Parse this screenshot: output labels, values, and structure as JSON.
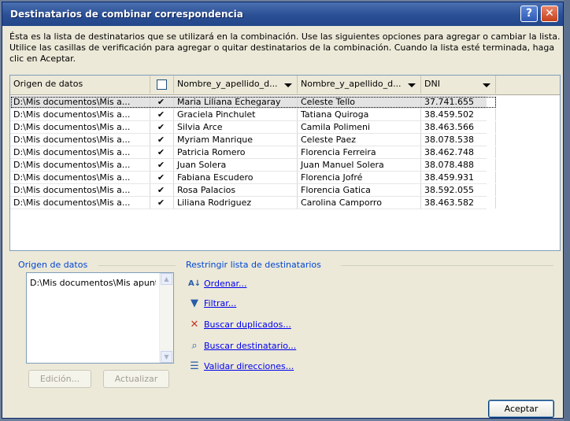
{
  "window": {
    "title": "Destinatarios de combinar correspondencia",
    "help_glyph": "?",
    "close_glyph": "✕"
  },
  "description": "Ésta es la lista de destinatarios que se utilizará en la combinación. Use las siguientes opciones para agregar o cambiar la lista. Utilice las casillas de verificación para agregar o quitar destinatarios de la combinación. Cuando la lista esté terminada, haga clic en Aceptar.",
  "grid": {
    "headers": {
      "origen": "Origen de datos",
      "nombre1": "Nombre_y_apellido_d...",
      "nombre2": "Nombre_y_apellido_d...",
      "dni": "DNI"
    },
    "rows": [
      {
        "origen": "D:\\Mis documentos\\Mis a...",
        "check": "✔",
        "nombre1": "Maria Liliana Echegaray",
        "nombre2": "Celeste  Tello",
        "dni": "37.741.655"
      },
      {
        "origen": "D:\\Mis documentos\\Mis a...",
        "check": "✔",
        "nombre1": "Graciela Pinchulet",
        "nombre2": "Tatiana Quiroga",
        "dni": "38.459.502"
      },
      {
        "origen": "D:\\Mis documentos\\Mis a...",
        "check": "✔",
        "nombre1": "Silvia Arce",
        "nombre2": "Camila Polimeni",
        "dni": "38.463.566"
      },
      {
        "origen": "D:\\Mis documentos\\Mis a...",
        "check": "✔",
        "nombre1": "Myriam Manrique",
        "nombre2": "Celeste Paez",
        "dni": "38.078.538"
      },
      {
        "origen": "D:\\Mis documentos\\Mis a...",
        "check": "✔",
        "nombre1": "Patricia Romero",
        "nombre2": "Florencia Ferreira",
        "dni": "38.462.748"
      },
      {
        "origen": "D:\\Mis documentos\\Mis a...",
        "check": "✔",
        "nombre1": "Juan Solera",
        "nombre2": "Juan Manuel Solera",
        "dni": "38.078.488"
      },
      {
        "origen": "D:\\Mis documentos\\Mis a...",
        "check": "✔",
        "nombre1": "Fabiana Escudero",
        "nombre2": "Florencia Jofré",
        "dni": "38.459.931"
      },
      {
        "origen": "D:\\Mis documentos\\Mis a...",
        "check": "✔",
        "nombre1": "Rosa Palacios",
        "nombre2": "Florencia Gatica",
        "dni": "38.592.055"
      },
      {
        "origen": "D:\\Mis documentos\\Mis a...",
        "check": "✔",
        "nombre1": "Liliana Rodriguez",
        "nombre2": "Carolina Camporro",
        "dni": "38.463.582"
      }
    ]
  },
  "origen_section": {
    "label": "Origen de datos",
    "item": "D:\\Mis documentos\\Mis apunte",
    "edit_button": "Edición...",
    "refresh_button": "Actualizar"
  },
  "restrict_section": {
    "label": "Restringir lista de destinatarios",
    "links": [
      {
        "label": "Ordenar...",
        "icon": "sort-az-icon"
      },
      {
        "label": "Filtrar...",
        "icon": "filter-icon"
      },
      {
        "label": "Buscar duplicados...",
        "icon": "find-duplicates-icon"
      },
      {
        "label": "Buscar destinatario...",
        "icon": "find-recipient-icon"
      },
      {
        "label": "Validar direcciones...",
        "icon": "validate-addresses-icon"
      }
    ]
  },
  "ok_button": "Aceptar"
}
